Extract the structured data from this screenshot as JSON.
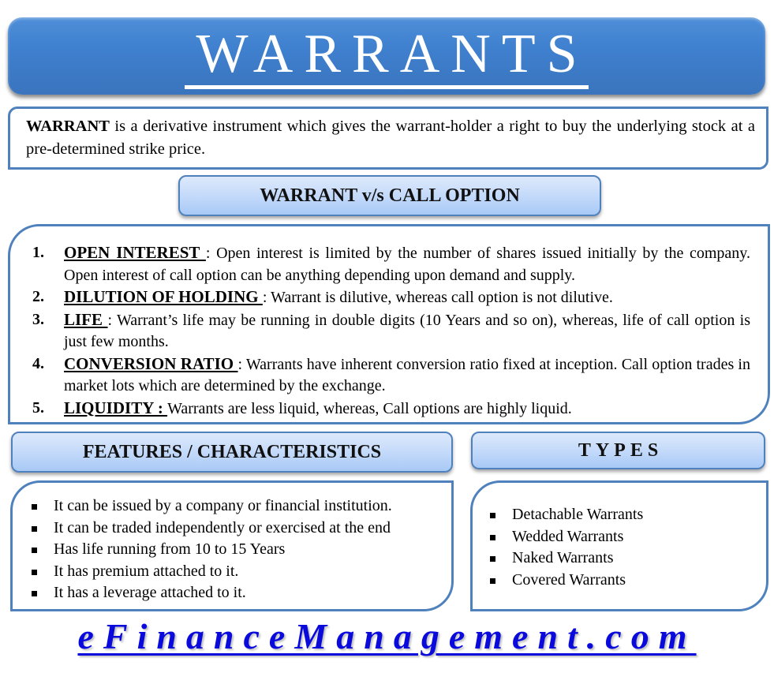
{
  "title": "WARRANTS",
  "definition": {
    "term": "WARRANT",
    "text": " is a derivative instrument which gives the warrant-holder a right to buy the underlying stock at a pre-determined strike price."
  },
  "comparison": {
    "heading": "WARRANT v/s CALL OPTION",
    "items": [
      {
        "num": "1.",
        "term": "OPEN INTEREST ",
        "sep": " : ",
        "text": "Open interest is limited by the number of shares issued initially by the company. Open interest of call option can be anything depending upon demand and supply."
      },
      {
        "num": "2.",
        "term": "DILUTION OF HOLDING ",
        "sep": ": ",
        "text": "Warrant is dilutive, whereas call option is not dilutive."
      },
      {
        "num": "3.",
        "term": "LIFE ",
        "sep": ": ",
        "text": "Warrant’s life may be running in double digits (10 Years and so on), whereas, life of call option is just few months."
      },
      {
        "num": "4.",
        "term": "CONVERSION RATIO ",
        "sep": " : ",
        "text": "Warrants have inherent conversion ratio fixed at inception. Call option trades in market lots which are determined by the exchange."
      },
      {
        "num": "5.",
        "term": "LIQUIDITY : ",
        "sep": "",
        "text": "Warrants are less liquid, whereas, Call options are highly liquid."
      }
    ]
  },
  "features": {
    "heading": "FEATURES / CHARACTERISTICS",
    "items": [
      "It can be issued by a company or financial institution.",
      "It can be traded independently or exercised at the end",
      "Has life running from 10 to 15 Years",
      "It has premium attached to it.",
      "It has a leverage attached to it."
    ]
  },
  "types": {
    "heading": "TYPES",
    "items": [
      "Detachable Warrants",
      "Wedded Warrants",
      "Naked Warrants",
      "Covered Warrants"
    ]
  },
  "footer": {
    "site": "eFinanceManagement.com"
  },
  "colors": {
    "banner": "#3f80cf",
    "border": "#4f81bd",
    "footer_link": "#0a0adc"
  }
}
